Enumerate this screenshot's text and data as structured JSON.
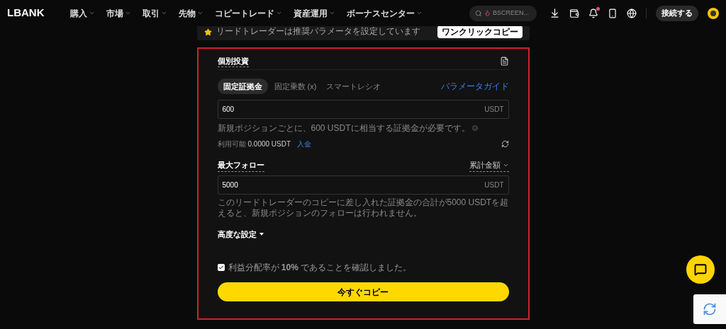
{
  "header": {
    "logo": "LBANK",
    "nav": [
      {
        "label": "購入"
      },
      {
        "label": "市場"
      },
      {
        "label": "取引"
      },
      {
        "label": "先物"
      },
      {
        "label": "コピートレード"
      },
      {
        "label": "資産運用"
      },
      {
        "label": "ボーナスセンター"
      }
    ],
    "search": {
      "placeholder": "BSCREEN..."
    },
    "notification_dot": true,
    "connect_button": "接続する"
  },
  "banner": {
    "text": "リードトレーダーは推奨パラメータを設定しています",
    "button": "ワンクリックコピー"
  },
  "form": {
    "title": "個別投資",
    "tabs": [
      {
        "label": "固定証拠金",
        "selected": true
      },
      {
        "label": "固定乗数 (x)",
        "selected": false
      },
      {
        "label": "スマートレシオ",
        "selected": false
      }
    ],
    "guide_link": "パラメータガイド",
    "margin": {
      "value": "600",
      "unit": "USDT"
    },
    "margin_help": "新規ポジションごとに、600 USDTに相当する証拠金が必要です。",
    "available_label": "利用可能",
    "available_value": "0.0000 USDT",
    "deposit_link": "入金",
    "max_follow_title": "最大フォロー",
    "max_follow_mode": "累計金額",
    "max_follow": {
      "value": "5000",
      "unit": "USDT"
    },
    "max_follow_help": "このリードトレーダーのコピーに差し入れた証拠金の合計が5000 USDTを超えると、新規ポジションのフォローは行われません。",
    "advanced": "高度な設定",
    "confirm": {
      "text": "利益分配率が **10%** であることを確認しました。",
      "checked": true
    },
    "submit": "今すぐコピー"
  }
}
